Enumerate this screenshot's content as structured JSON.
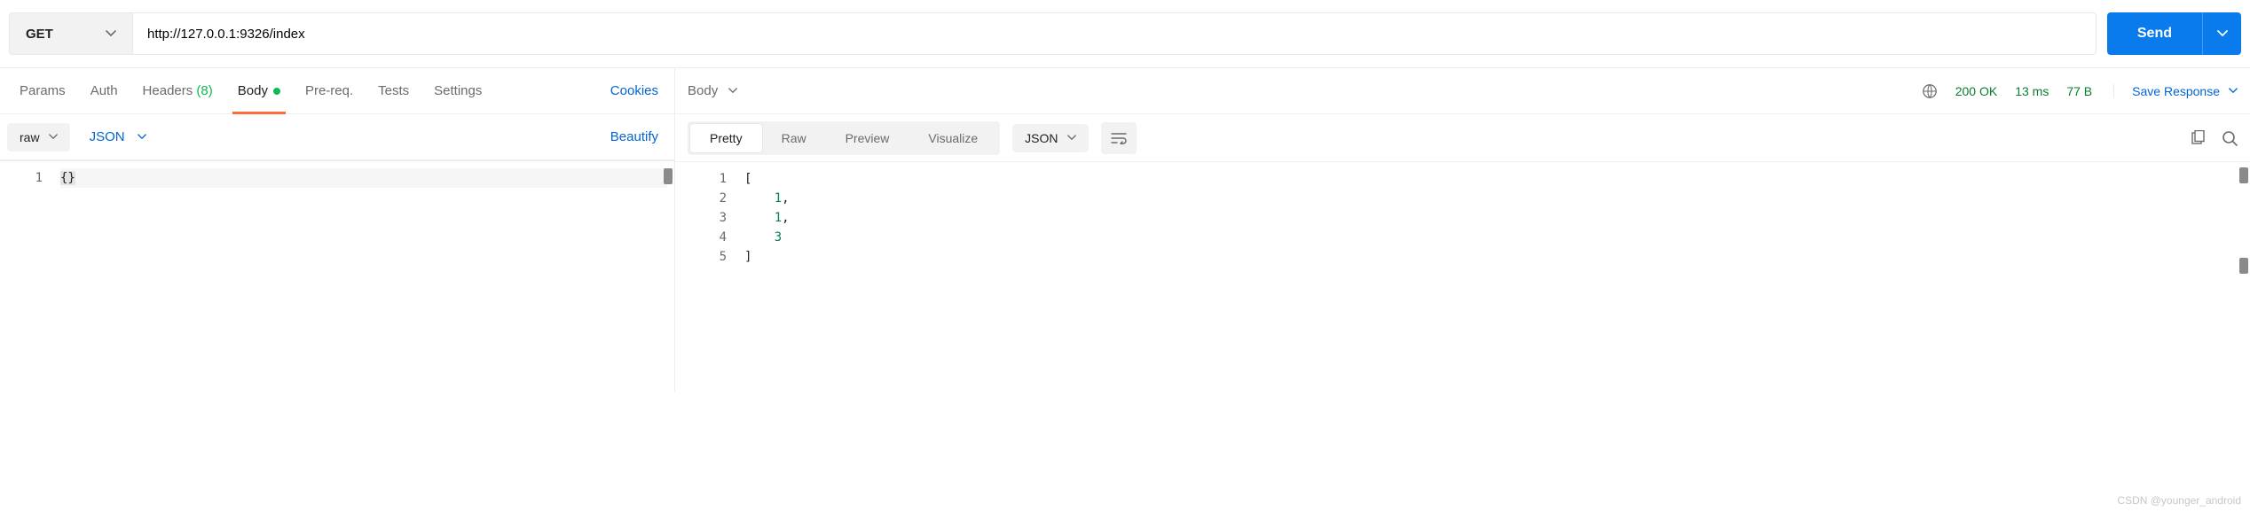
{
  "request": {
    "method": "GET",
    "url": "http://127.0.0.1:9326/index",
    "send_label": "Send"
  },
  "req_tabs": {
    "params": "Params",
    "auth": "Auth",
    "headers": "Headers",
    "headers_count": "(8)",
    "body": "Body",
    "prereq": "Pre-req.",
    "tests": "Tests",
    "settings": "Settings",
    "cookies": "Cookies"
  },
  "body_ctrl": {
    "mode": "raw",
    "lang": "JSON",
    "beautify": "Beautify"
  },
  "req_body": {
    "lines": [
      "1"
    ],
    "code": [
      "{}"
    ]
  },
  "resp_header": {
    "body_label": "Body",
    "status": "200 OK",
    "time": "13 ms",
    "size": "77 B",
    "save_label": "Save Response"
  },
  "resp_ctrl": {
    "pretty": "Pretty",
    "raw": "Raw",
    "preview": "Preview",
    "visualize": "Visualize",
    "lang": "JSON"
  },
  "resp_body": {
    "line_nums": [
      "1",
      "2",
      "3",
      "4",
      "5"
    ],
    "lines": [
      {
        "indent": "",
        "text": "[",
        "num": null,
        "suffix": ""
      },
      {
        "indent": "    ",
        "text": "",
        "num": "1",
        "suffix": ","
      },
      {
        "indent": "    ",
        "text": "",
        "num": "1",
        "suffix": ","
      },
      {
        "indent": "    ",
        "text": "",
        "num": "3",
        "suffix": ""
      },
      {
        "indent": "",
        "text": "]",
        "num": null,
        "suffix": ""
      }
    ]
  },
  "watermark": "CSDN @younger_android"
}
